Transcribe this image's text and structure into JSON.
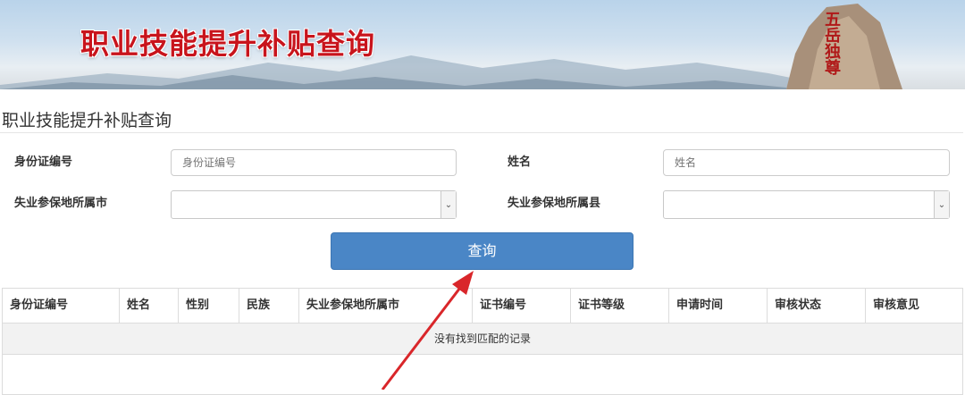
{
  "banner": {
    "title": "职业技能提升补贴查询",
    "rock_text": "五岳独尊"
  },
  "page_title": "职业技能提升补贴查询",
  "form": {
    "id_label": "身份证编号",
    "id_placeholder": "身份证编号",
    "name_label": "姓名",
    "name_placeholder": "姓名",
    "city_label": "失业参保地所属市",
    "county_label": "失业参保地所属县",
    "query_button": "查询"
  },
  "table": {
    "headers": [
      "身份证编号",
      "姓名",
      "性别",
      "民族",
      "失业参保地所属市",
      "证书编号",
      "证书等级",
      "申请时间",
      "审核状态",
      "审核意见"
    ],
    "empty_text": "没有找到匹配的记录"
  },
  "colors": {
    "banner_title": "#c8141c",
    "button": "#4a86c6",
    "annotation_arrow": "#d9262a"
  }
}
